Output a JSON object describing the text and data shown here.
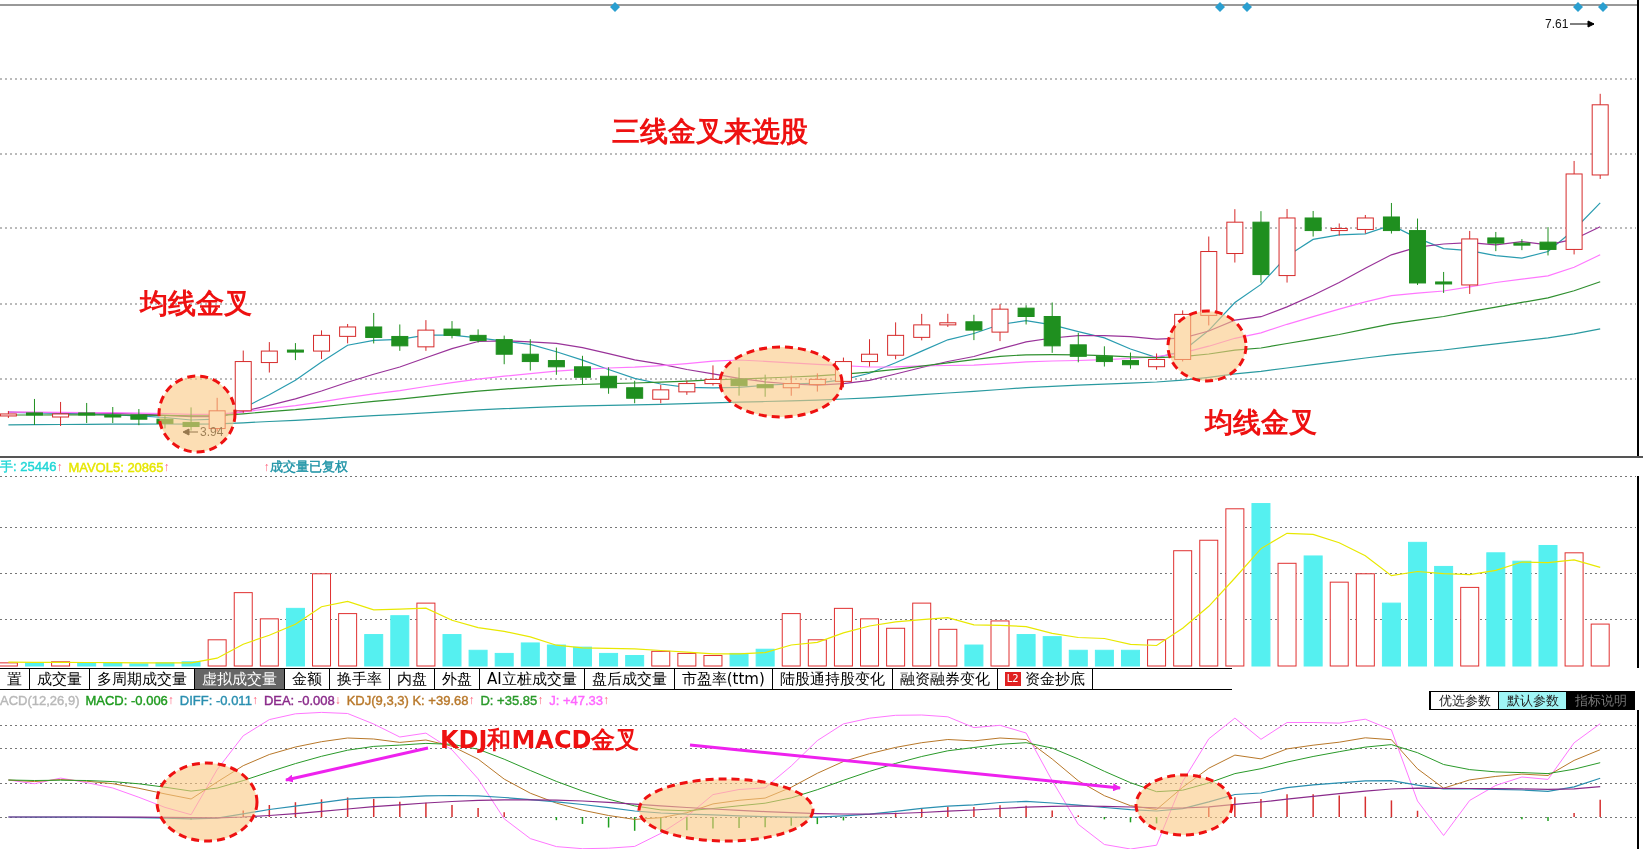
{
  "price_chart": {
    "price_marks": [
      {
        "text": "7.61",
        "kind": "high"
      },
      {
        "text": "3.94",
        "kind": "low"
      }
    ]
  },
  "volume_legend": [
    {
      "text": "手: 25446",
      "arrow": "↑",
      "color": "#22d6d6"
    },
    {
      "text": "MAVOL5: 20865",
      "arrow": "↑",
      "color": "#e6e600"
    },
    {
      "text": "成交量已复权",
      "arrow": "↑",
      "color": "#1e93a6"
    }
  ],
  "tabs": [
    {
      "label": "置",
      "selected": false
    },
    {
      "label": "成交量",
      "selected": false
    },
    {
      "label": "多周期成交量",
      "selected": false
    },
    {
      "label": "虚拟成交量",
      "selected": true
    },
    {
      "label": "金额",
      "selected": false
    },
    {
      "label": "换手率",
      "selected": false
    },
    {
      "label": "内盘",
      "selected": false
    },
    {
      "label": "外盘",
      "selected": false
    },
    {
      "label": "AI立桩成交量",
      "selected": false
    },
    {
      "label": "盘后成交量",
      "selected": false
    },
    {
      "label": "市盈率(ttm)",
      "selected": false
    },
    {
      "label": "陆股通持股变化",
      "selected": false
    },
    {
      "label": "融资融券变化",
      "selected": false
    },
    {
      "label": "资金抄底",
      "selected": false,
      "badge": "L2"
    }
  ],
  "indicator_legend": [
    {
      "text": "ACD(12,26,9)",
      "color": "#b8b8b8"
    },
    {
      "text": "MACD: -0.006",
      "arrow": "↑",
      "color": "#1f9b1f"
    },
    {
      "text": "DIFF: -0.011",
      "arrow": "↑",
      "color": "#2a8fb0"
    },
    {
      "text": "DEA: -0.008",
      "arrow": "↓",
      "color": "#8a2a8a"
    },
    {
      "text": "KDJ(9,3,3) K: +39.68",
      "arrow": "↑",
      "color": "#b8782a"
    },
    {
      "text": "D: +35.85",
      "arrow": "↑",
      "color": "#2a9a2a"
    },
    {
      "text": "J: +47.33",
      "arrow": "↑",
      "color": "#ff66ff"
    }
  ],
  "indicator_buttons": [
    {
      "label": "优选参数",
      "selected": false,
      "disabled": false
    },
    {
      "label": "默认参数",
      "selected": true,
      "disabled": false
    },
    {
      "label": "指标说明",
      "selected": false,
      "disabled": true
    }
  ],
  "annotations": {
    "title": "三线金叉来选股",
    "labels": [
      "均线金叉",
      "均线金叉",
      "KDJ和MACD金叉"
    ]
  }
}
